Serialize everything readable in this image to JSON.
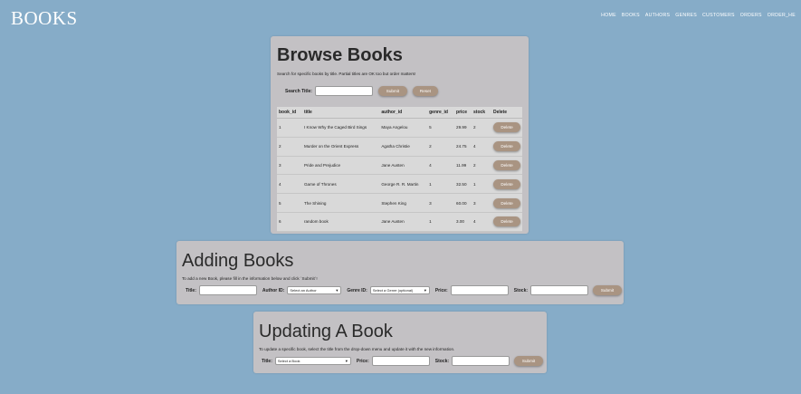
{
  "site": {
    "logo": "BOOKS",
    "nav": [
      "HOME",
      "BOOKS",
      "AUTHORS",
      "GENRES",
      "CUSTOMERS",
      "ORDERS",
      "ORDER_HE"
    ]
  },
  "browse": {
    "title": "Browse Books",
    "description": "Search for specific books by title. Partial titles are OK too but order matters!",
    "search_label": "Search Title:",
    "search_value": "",
    "submit_label": "Submit",
    "reset_label": "Reset",
    "columns": [
      "book_id",
      "title",
      "author_id",
      "genre_id",
      "price",
      "stock",
      "Delete"
    ],
    "rows": [
      {
        "book_id": "1",
        "title": "I Know Why the Caged Bird Sings",
        "author": "Maya Angelou",
        "genre_id": "5",
        "price": "29.99",
        "stock": "2"
      },
      {
        "book_id": "2",
        "title": "Murder on the Orient Express",
        "author": "Agatha Christie",
        "genre_id": "2",
        "price": "24.75",
        "stock": "4"
      },
      {
        "book_id": "3",
        "title": "Pride and Prejudice",
        "author": "Jane Austen",
        "genre_id": "4",
        "price": "11.99",
        "stock": "2"
      },
      {
        "book_id": "4",
        "title": "Game of Thrones",
        "author": "George R. R. Martin",
        "genre_id": "1",
        "price": "32.50",
        "stock": "1"
      },
      {
        "book_id": "5",
        "title": "The Shining",
        "author": "Stephen King",
        "genre_id": "3",
        "price": "60.00",
        "stock": "3"
      },
      {
        "book_id": "6",
        "title": "random book",
        "author": "Jane Austen",
        "genre_id": "1",
        "price": "3.00",
        "stock": "4"
      }
    ],
    "delete_label": "Delete"
  },
  "adding": {
    "title": "Adding Books",
    "description": "To add a new Book, please fill in the information below and click `Submit`!",
    "title_label": "Title:",
    "author_label": "Author ID:",
    "author_select": "Select an Author",
    "genre_label": "Genre ID:",
    "genre_select": "Select a Genre (optional)",
    "price_label": "Price:",
    "stock_label": "Stock:",
    "submit_label": "Submit"
  },
  "updating": {
    "title": "Updating A Book",
    "description": "To update a specific book, select the title from the drop-down menu and update it with the new information.",
    "title_label": "Title:",
    "book_select": "Select a Book",
    "price_label": "Price:",
    "stock_label": "Stock:",
    "submit_label": "Submit"
  },
  "colors": {
    "page_background": "#86acc8",
    "panel": "#c3c1c4",
    "button": "#a99482",
    "table": "#d9d9d9"
  }
}
